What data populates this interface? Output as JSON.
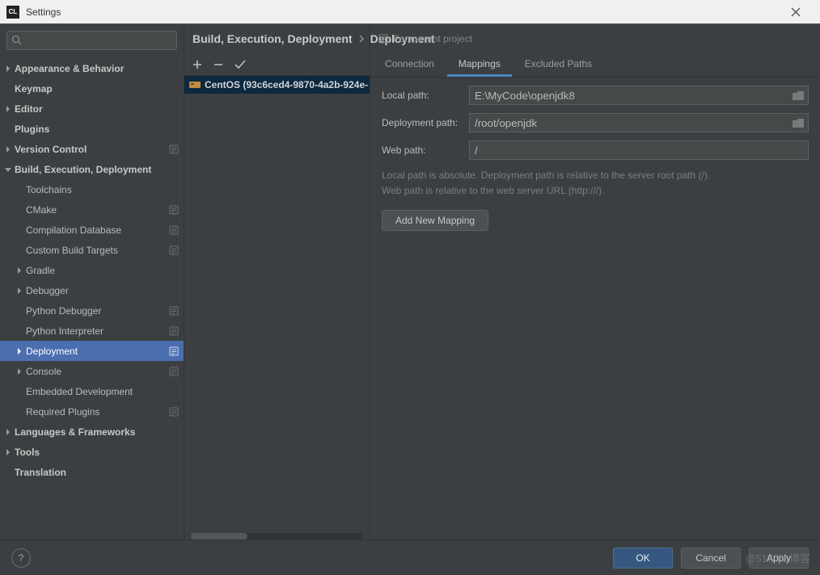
{
  "window": {
    "title": "Settings",
    "app_icon_text": "CL"
  },
  "search": {
    "placeholder": ""
  },
  "tree": {
    "items": [
      {
        "label": "Appearance & Behavior",
        "level": 0,
        "arrow": "right",
        "bold": true,
        "badge": false,
        "selected": false
      },
      {
        "label": "Keymap",
        "level": 0,
        "arrow": "none",
        "bold": true,
        "badge": false,
        "selected": false
      },
      {
        "label": "Editor",
        "level": 0,
        "arrow": "right",
        "bold": true,
        "badge": false,
        "selected": false
      },
      {
        "label": "Plugins",
        "level": 0,
        "arrow": "none",
        "bold": true,
        "badge": false,
        "selected": false
      },
      {
        "label": "Version Control",
        "level": 0,
        "arrow": "right",
        "bold": true,
        "badge": true,
        "selected": false
      },
      {
        "label": "Build, Execution, Deployment",
        "level": 0,
        "arrow": "down",
        "bold": true,
        "badge": false,
        "selected": false
      },
      {
        "label": "Toolchains",
        "level": 1,
        "arrow": "none",
        "bold": false,
        "badge": false,
        "selected": false
      },
      {
        "label": "CMake",
        "level": 1,
        "arrow": "none",
        "bold": false,
        "badge": true,
        "selected": false
      },
      {
        "label": "Compilation Database",
        "level": 1,
        "arrow": "none",
        "bold": false,
        "badge": true,
        "selected": false
      },
      {
        "label": "Custom Build Targets",
        "level": 1,
        "arrow": "none",
        "bold": false,
        "badge": true,
        "selected": false
      },
      {
        "label": "Gradle",
        "level": 1,
        "arrow": "right",
        "bold": false,
        "badge": false,
        "selected": false
      },
      {
        "label": "Debugger",
        "level": 1,
        "arrow": "right",
        "bold": false,
        "badge": false,
        "selected": false
      },
      {
        "label": "Python Debugger",
        "level": 1,
        "arrow": "none",
        "bold": false,
        "badge": true,
        "selected": false
      },
      {
        "label": "Python Interpreter",
        "level": 1,
        "arrow": "none",
        "bold": false,
        "badge": true,
        "selected": false
      },
      {
        "label": "Deployment",
        "level": 1,
        "arrow": "right",
        "bold": false,
        "badge": true,
        "selected": true
      },
      {
        "label": "Console",
        "level": 1,
        "arrow": "right",
        "bold": false,
        "badge": true,
        "selected": false
      },
      {
        "label": "Embedded Development",
        "level": 1,
        "arrow": "none",
        "bold": false,
        "badge": false,
        "selected": false
      },
      {
        "label": "Required Plugins",
        "level": 1,
        "arrow": "none",
        "bold": false,
        "badge": true,
        "selected": false
      },
      {
        "label": "Languages & Frameworks",
        "level": 0,
        "arrow": "right",
        "bold": true,
        "badge": false,
        "selected": false
      },
      {
        "label": "Tools",
        "level": 0,
        "arrow": "right",
        "bold": true,
        "badge": false,
        "selected": false
      },
      {
        "label": "Translation",
        "level": 0,
        "arrow": "none",
        "bold": true,
        "badge": false,
        "selected": false
      }
    ]
  },
  "breadcrumb": {
    "part0": "Build, Execution, Deployment",
    "part1": "Deployment"
  },
  "project_hint": "For current project",
  "servers": {
    "items": [
      {
        "label": "CentOS (93c6ced4-9870-4a2b-924e-"
      }
    ]
  },
  "tabs": {
    "connection": "Connection",
    "mappings": "Mappings",
    "excluded": "Excluded Paths"
  },
  "form": {
    "local_path_label": "Local path:",
    "local_path_value": "E:\\MyCode\\openjdk8",
    "deployment_path_label": "Deployment path:",
    "deployment_path_value": "/root/openjdk",
    "web_path_label": "Web path:",
    "web_path_value": "/",
    "help_line1": "Local path is absolute. Deployment path is relative to the server root path (/).",
    "help_line2": "Web path is relative to the web server URL (http:///).",
    "add_mapping": "Add New Mapping"
  },
  "footer": {
    "ok": "OK",
    "cancel": "Cancel",
    "apply": "Apply"
  },
  "watermark": "@51CTO博客"
}
